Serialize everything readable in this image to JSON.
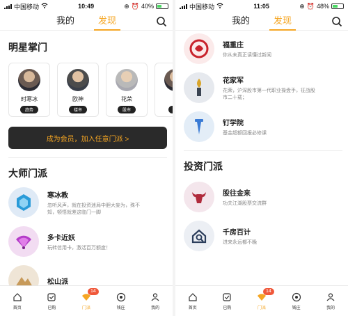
{
  "left": {
    "status": {
      "carrier": "中国移动",
      "time": "10:49",
      "battery": "40%",
      "battery_level": 0.4
    },
    "nav": {
      "tab1": "我的",
      "tab2": "发现"
    },
    "stars_title": "明星掌门",
    "stars": [
      {
        "name": "时寒冰",
        "tag": "趋势"
      },
      {
        "name": "欧神",
        "tag": "楼市"
      },
      {
        "name": "花荣",
        "tag": "股市"
      },
      {
        "name": "如",
        "tag": "趋"
      }
    ],
    "vip_label": "成为会员，加入任意门派 >",
    "masters_title": "大师门派",
    "masters": [
      {
        "title": "寒冰教",
        "desc1": "忽听风声，就在投资迷局中胆大妄为，殊不",
        "desc2": "知，顿悟就差这临门一脚",
        "color": "#dfeaf6",
        "icon": "lion-icon"
      },
      {
        "title": "多卡近妖",
        "desc1": "玩转信用卡，激活百万额度！",
        "desc2": "",
        "color": "#f2dcf2",
        "icon": "fan-icon"
      },
      {
        "title": "松山派",
        "desc1": "",
        "desc2": "",
        "color": "#efe5d6",
        "icon": "mountain-icon"
      }
    ],
    "tabbar": [
      "首页",
      "已购",
      "门派",
      "钱庄",
      "我的"
    ],
    "badge": "14"
  },
  "right": {
    "status": {
      "carrier": "中国移动",
      "time": "11:05",
      "battery": "48%",
      "battery_level": 0.48
    },
    "nav": {
      "tab1": "我的",
      "tab2": "发现"
    },
    "masters": [
      {
        "title": "福重庄",
        "desc1": "你从未真正读懂过新闻",
        "desc2": "",
        "color": "#fbeaea",
        "icon": "dragon-icon"
      },
      {
        "title": "花家军",
        "desc1": "花荣，沪深股市第一代职业操盘手，征战股",
        "desc2": "市二十载；",
        "color": "#e6e9ee",
        "icon": "torch-icon"
      },
      {
        "title": "钉学院",
        "desc1": "基金超额回报必修课",
        "desc2": "",
        "color": "#e3edf7",
        "icon": "nail-icon"
      }
    ],
    "invest_title": "投资门派",
    "invest": [
      {
        "title": "股往金来",
        "desc1": "功夫江湖股票交流群",
        "desc2": "",
        "color": "#f4e6ec",
        "icon": "bull-icon"
      },
      {
        "title": "千房百计",
        "desc1": "进来永远都不晚",
        "desc2": "",
        "color": "#eceff4",
        "icon": "house-icon"
      }
    ],
    "tabbar": [
      "首页",
      "已购",
      "门派",
      "钱庄",
      "我的"
    ],
    "badge": "14"
  }
}
